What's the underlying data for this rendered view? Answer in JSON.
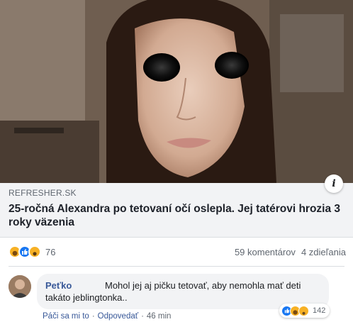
{
  "link_preview": {
    "domain": "REFRESHER.SK",
    "headline": "25-ročná Alexandra po tetovaní očí oslepla. Jej tatérovi hrozia 3 roky väzenia",
    "info_icon": "info-icon"
  },
  "stats": {
    "reaction_icons": [
      "haha",
      "like",
      "wow"
    ],
    "reaction_count": "76",
    "comments": "59 komentárov",
    "shares": "4 zdieľania"
  },
  "comment": {
    "author": "Peťko",
    "text": "Mohol jej aj pičku tetovať, aby nemohla mať deti takáto jeblingtonka..",
    "reaction_icons": [
      "like",
      "haha",
      "sad"
    ],
    "reaction_count": "142",
    "like_label": "Páči sa mi to",
    "reply_label": "Odpovedať",
    "time": "46 min",
    "separator": "·"
  },
  "colors": {
    "link": "#385898",
    "like": "#1877f2",
    "haha": "#f7b125",
    "preview_bg": "#f2f3f5"
  }
}
